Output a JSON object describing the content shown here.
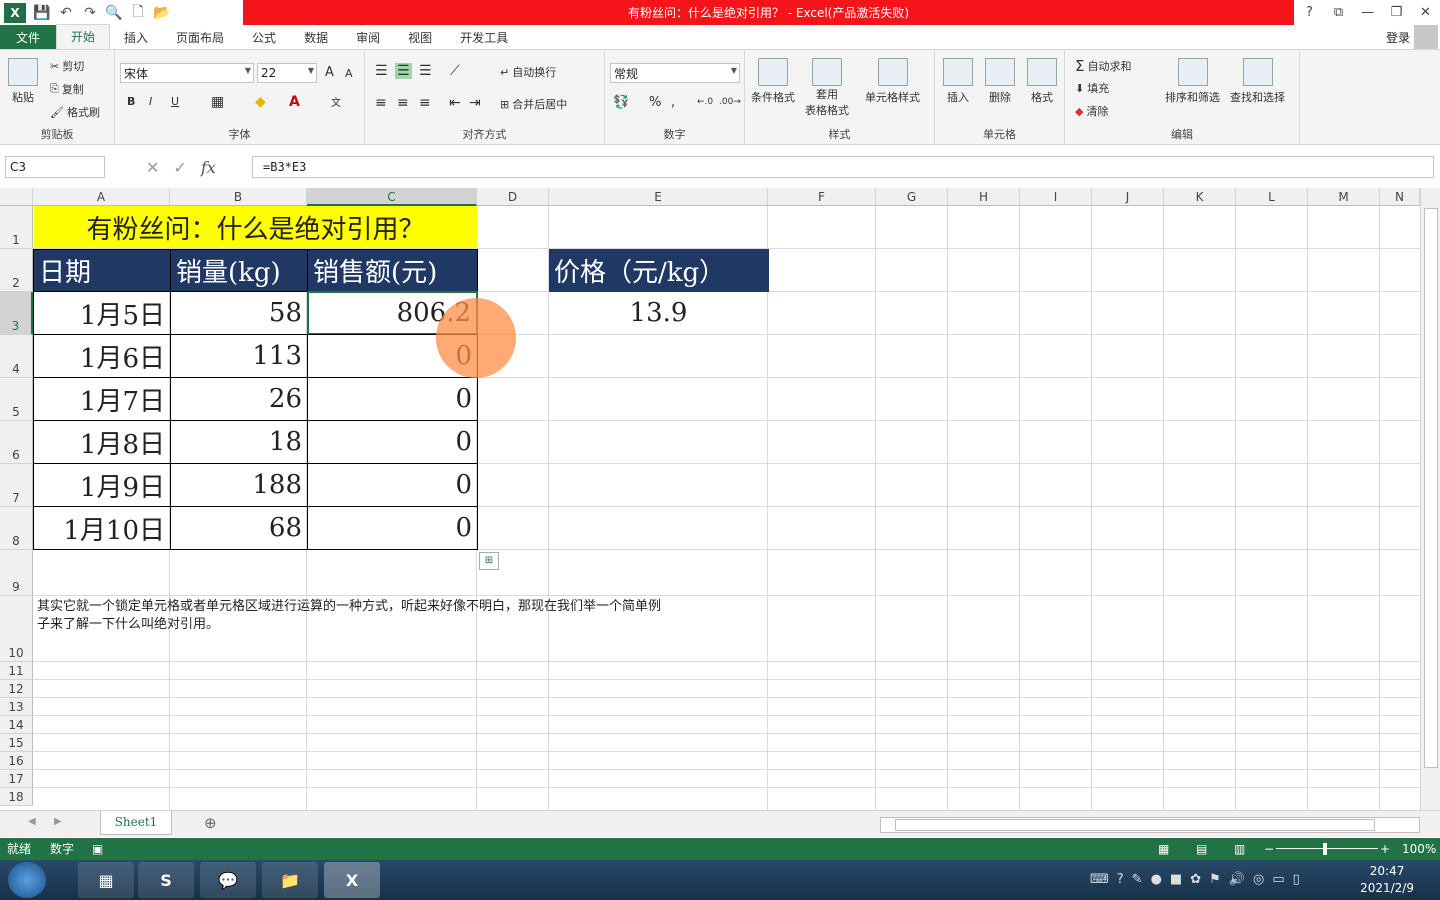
{
  "window": {
    "title": "有粉丝问：什么是绝对引用？ - Excel(产品激活失败)",
    "help": "?",
    "controls": [
      "⧉",
      "—",
      "❐",
      "✕"
    ]
  },
  "ribbon_tabs": [
    "文件",
    "开始",
    "插入",
    "页面布局",
    "公式",
    "数据",
    "审阅",
    "视图",
    "开发工具"
  ],
  "login": "登录",
  "clipboard": {
    "paste": "粘贴",
    "cut": "剪切",
    "copy": "复制",
    "format_painter": "格式刷",
    "label": "剪贴板"
  },
  "font": {
    "name": "宋体",
    "size": "22",
    "label": "字体",
    "bold": "B",
    "italic": "I",
    "underline": "U",
    "grow": "A",
    "shrink": "A"
  },
  "alignment": {
    "wrap": "自动换行",
    "merge": "合并后居中",
    "label": "对齐方式"
  },
  "number": {
    "format": "常规",
    "label": "数字",
    "percent": "%",
    "comma": ","
  },
  "styles": {
    "conditional": "条件格式",
    "table_line1": "套用",
    "table_line2": "表格格式",
    "cell_styles": "单元格样式",
    "label": "样式"
  },
  "cells": {
    "insert": "插入",
    "delete": "删除",
    "format": "格式",
    "label": "单元格"
  },
  "editing": {
    "autosum": "自动求和",
    "fill": "填充",
    "clear": "清除",
    "sort": "排序和筛选",
    "find": "查找和选择",
    "label": "编辑"
  },
  "formula_bar": {
    "name_box": "C3",
    "formula": "=B3*E3",
    "fx": "fx"
  },
  "columns": [
    "A",
    "B",
    "C",
    "D",
    "E",
    "F",
    "G",
    "H",
    "I",
    "J",
    "K",
    "L",
    "M",
    "N"
  ],
  "rows": [
    "1",
    "2",
    "3",
    "4",
    "5",
    "6",
    "7",
    "8",
    "9",
    "10",
    "11",
    "12",
    "13",
    "14",
    "15",
    "16",
    "17",
    "18"
  ],
  "sheet": {
    "title": "有粉丝问：什么是绝对引用？",
    "headers": [
      "日期",
      "销量(kg)",
      "销售额(元)"
    ],
    "price_header": "价格（元/kg）",
    "price_value": "13.9",
    "data": [
      [
        "1月5日",
        "58",
        "806.2"
      ],
      [
        "1月6日",
        "113",
        "0"
      ],
      [
        "1月7日",
        "26",
        "0"
      ],
      [
        "1月8日",
        "18",
        "0"
      ],
      [
        "1月9日",
        "188",
        "0"
      ],
      [
        "1月10日",
        "68",
        "0"
      ]
    ],
    "note_line1": "其实它就一个锁定单元格或者单元格区域进行运算的一种方式，听起来好像不明白，那现在我们举一个简单例",
    "note_line2": "子来了解一下什么叫绝对引用。"
  },
  "sheet_tab": "Sheet1",
  "status": {
    "ready": "就绪",
    "num": "数字",
    "zoom": "100%"
  },
  "clock": {
    "time": "20:47",
    "date": "2021/2/9"
  },
  "colors": {
    "excel_green": "#217346",
    "title_red": "#f4141a",
    "header_navy": "#1f3864",
    "title_yellow": "#ffff00"
  }
}
